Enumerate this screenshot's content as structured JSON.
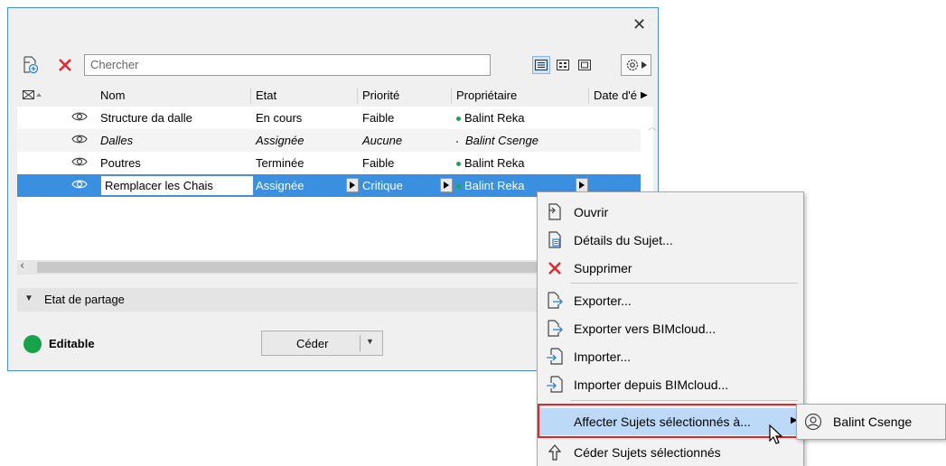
{
  "window": {
    "close_glyph": "✕"
  },
  "toolbar": {
    "new_icon": "new-issue-icon",
    "delete_icon": "delete-icon",
    "search_placeholder": "Chercher",
    "view_icons": [
      "list-view-icon",
      "grid-view-icon",
      "single-view-icon"
    ],
    "settings_icon": "gear-icon"
  },
  "table": {
    "columns": [
      "Nom",
      "Etat",
      "Priorité",
      "Propriétaire",
      "Date d'é"
    ],
    "rows": [
      {
        "name": "Structure da dalle",
        "state": "En cours",
        "priority": "Faible",
        "owner": "Balint Reka",
        "italic": false,
        "selected": false
      },
      {
        "name": "Dalles",
        "state": "Assignée",
        "priority": "Aucune",
        "owner": "Balint Csenge",
        "italic": true,
        "selected": false
      },
      {
        "name": "Poutres",
        "state": "Terminée",
        "priority": "Faible",
        "owner": "Balint Reka",
        "italic": false,
        "selected": false
      },
      {
        "name": "Remplacer les Chais",
        "state": "Assignée",
        "priority": "Critique",
        "owner": "Balint Reka",
        "italic": false,
        "selected": true
      }
    ]
  },
  "section": {
    "label": "Etat de partage"
  },
  "status": {
    "label": "Editable",
    "color": "#17a34a"
  },
  "ceder_button": {
    "label": "Céder"
  },
  "context_menu": {
    "items": [
      {
        "label": "Ouvrir",
        "icon": "open-icon"
      },
      {
        "label": "Détails du Sujet...",
        "icon": "details-icon"
      },
      {
        "label": "Supprimer",
        "icon": "delete-icon"
      },
      {
        "label": "Exporter...",
        "icon": "export-icon"
      },
      {
        "label": "Exporter vers BIMcloud...",
        "icon": "export-icon"
      },
      {
        "label": "Importer...",
        "icon": "import-icon"
      },
      {
        "label": "Importer depuis BIMcloud...",
        "icon": "import-icon"
      },
      {
        "label": "Affecter Sujets sélectionnés à...",
        "icon": "",
        "highlighted": true
      },
      {
        "label": "Céder Sujets sélectionnés",
        "icon": "release-icon"
      }
    ]
  },
  "submenu": {
    "label": "Balint Csenge",
    "icon": "user-icon"
  },
  "colors": {
    "selection": "#3b8fe0",
    "menu_highlight": "#bcd9f7",
    "callout": "#e0252b"
  }
}
